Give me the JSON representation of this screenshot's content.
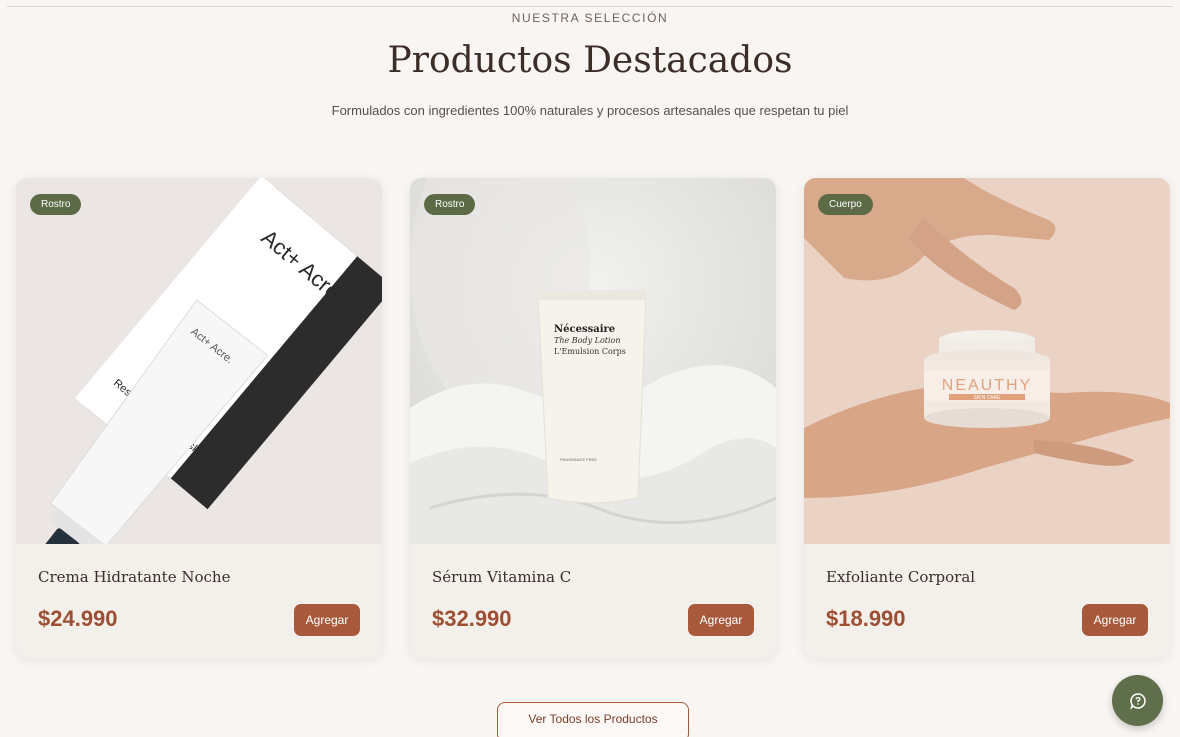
{
  "section": {
    "eyebrow": "NUESTRA SELECCIÓN",
    "title": "Productos Destacados",
    "subtitle": "Formulados con ingredientes 100% naturales y procesos artesanales que respetan tu piel"
  },
  "products": [
    {
      "category": "Rostro",
      "name": "Crema Hidratante Noche",
      "price": "$24.990",
      "add_label": "Agregar",
      "image": {
        "brand": "Act+ Acre.",
        "box_text": "Restorative Hair Mask",
        "tube_text": "Restorative Hair Mask"
      }
    },
    {
      "category": "Rostro",
      "name": "Sérum Vitamina C",
      "price": "$32.990",
      "add_label": "Agregar",
      "image": {
        "brand": "Nécessaire",
        "line1": "The Body Lotion",
        "line2": "L'Emulsion Corps",
        "small": "FRAGRANCE FREE"
      }
    },
    {
      "category": "Cuerpo",
      "name": "Exfoliante Corporal",
      "price": "$18.990",
      "add_label": "Agregar",
      "image": {
        "brand": "NEAUTHY",
        "sub": "SKIN CARE"
      }
    }
  ],
  "view_all_label": "Ver Todos los Productos",
  "help_fab": {
    "icon": "chat-help-icon"
  },
  "colors": {
    "background": "#f8f5f2",
    "accent": "#a8593b",
    "price": "#9c4f33",
    "badge": "#5c6b46",
    "fab": "#5f6e4b"
  }
}
